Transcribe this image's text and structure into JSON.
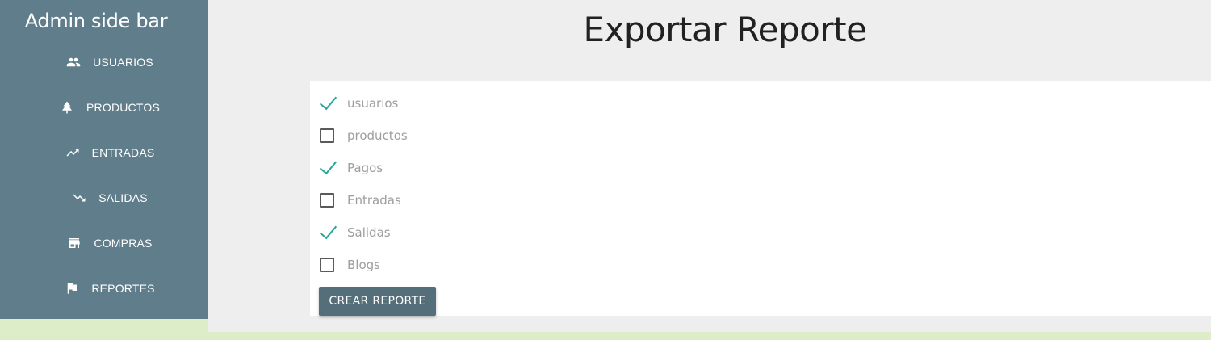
{
  "sidebar": {
    "title": "Admin side bar",
    "items": [
      {
        "label": "USUARIOS",
        "icon": "people-icon"
      },
      {
        "label": "PRODUCTOS",
        "icon": "tree-icon"
      },
      {
        "label": "ENTRADAS",
        "icon": "trending-up-icon"
      },
      {
        "label": "SALIDAS",
        "icon": "trending-down-icon"
      },
      {
        "label": "COMPRAS",
        "icon": "store-icon"
      },
      {
        "label": "REPORTES",
        "icon": "flag-icon"
      }
    ]
  },
  "main": {
    "title": "Exportar Reporte",
    "options": [
      {
        "label": "usuarios",
        "checked": true
      },
      {
        "label": "productos",
        "checked": false
      },
      {
        "label": "Pagos",
        "checked": true
      },
      {
        "label": "Entradas",
        "checked": false
      },
      {
        "label": "Salidas",
        "checked": true
      },
      {
        "label": "Blogs",
        "checked": false
      }
    ],
    "button_label": "CREAR REPORTE"
  },
  "colors": {
    "sidebar_bg": "#607d8b",
    "button_bg": "#546e7a",
    "check_color": "#26a69a",
    "page_bg": "#dcedc8",
    "main_bg": "#eeeeee"
  }
}
